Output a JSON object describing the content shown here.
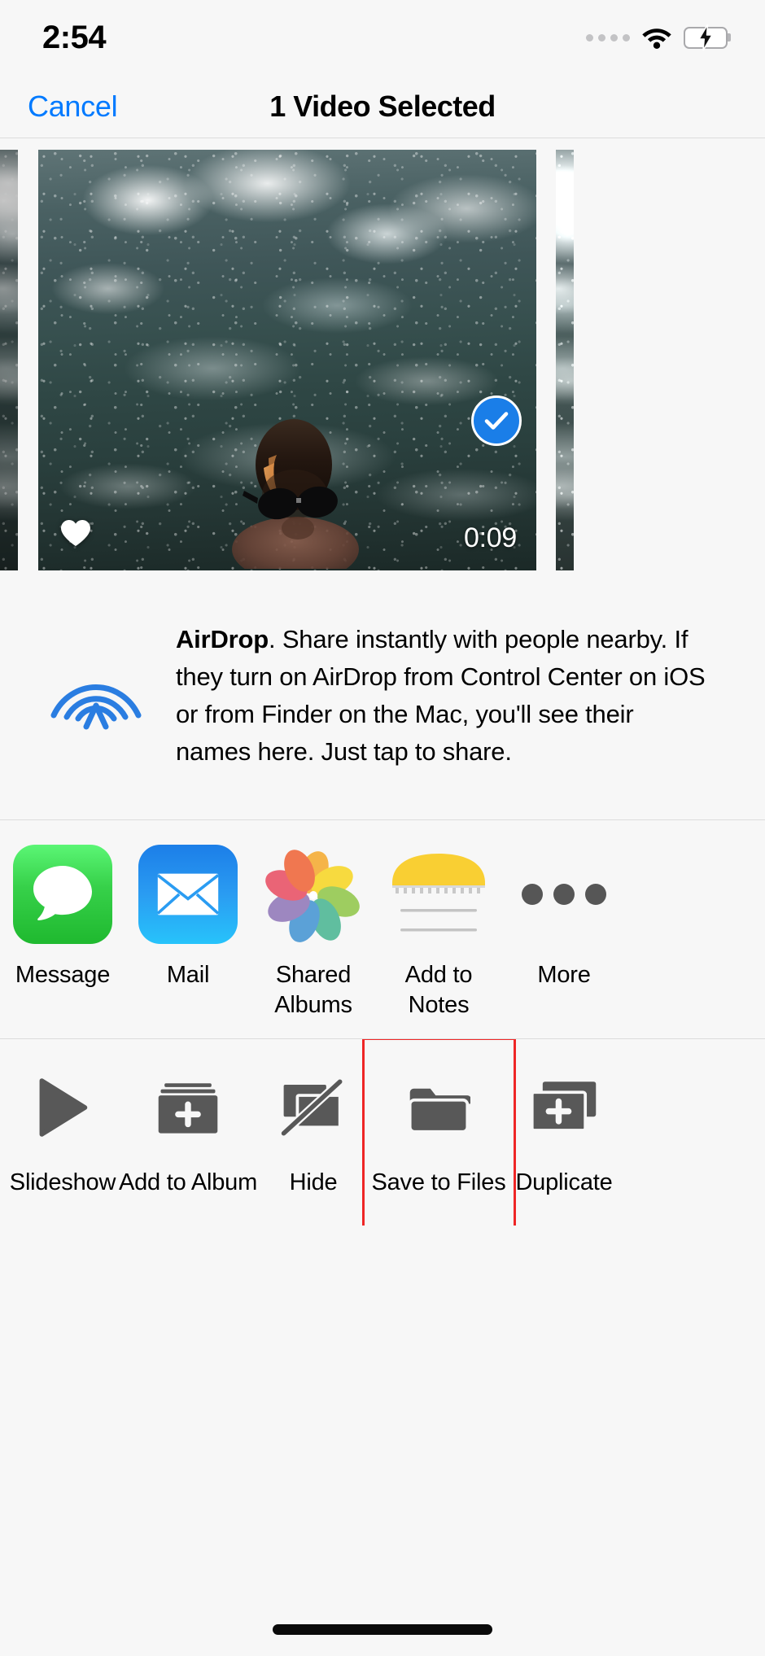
{
  "status_bar": {
    "time": "2:54",
    "signal_icon": "signal-dots-icon",
    "wifi_icon": "wifi-icon",
    "battery_icon": "battery-charging-icon"
  },
  "nav": {
    "cancel_label": "Cancel",
    "title": "1 Video Selected"
  },
  "thumbnails": {
    "selected": {
      "duration": "0:09",
      "favorite_icon": "heart-icon",
      "selected_icon": "check-circle-icon",
      "selected": true
    }
  },
  "airdrop": {
    "icon": "airdrop-icon",
    "title": "AirDrop",
    "body": ". Share instantly with people nearby. If they turn on AirDrop from Control Center on iOS or from Finder on the Mac, you'll see their names here. Just tap to share."
  },
  "app_row": {
    "items": [
      {
        "label": "Message",
        "icon": "messages-icon"
      },
      {
        "label": "Mail",
        "icon": "mail-icon"
      },
      {
        "label": "Shared\nAlbums",
        "icon": "photos-icon"
      },
      {
        "label": "Add to Notes",
        "icon": "notes-icon"
      },
      {
        "label": "More",
        "icon": "more-dots-icon"
      }
    ]
  },
  "action_row": {
    "items": [
      {
        "label": "Slideshow",
        "icon": "play-icon",
        "highlighted": false
      },
      {
        "label": "Add to Album",
        "icon": "add-to-album-icon",
        "highlighted": false
      },
      {
        "label": "Hide",
        "icon": "hide-icon",
        "highlighted": false
      },
      {
        "label": "Save to Files",
        "icon": "folder-icon",
        "highlighted": true
      },
      {
        "label": "Duplicate",
        "icon": "duplicate-icon",
        "highlighted": false
      }
    ]
  },
  "colors": {
    "accent_blue": "#007aff",
    "check_blue": "#1a7ee8",
    "highlight_red": "#ef2626",
    "battery_green": "#30d158",
    "background": "#f7f7f7"
  },
  "home_indicator": "home-indicator"
}
